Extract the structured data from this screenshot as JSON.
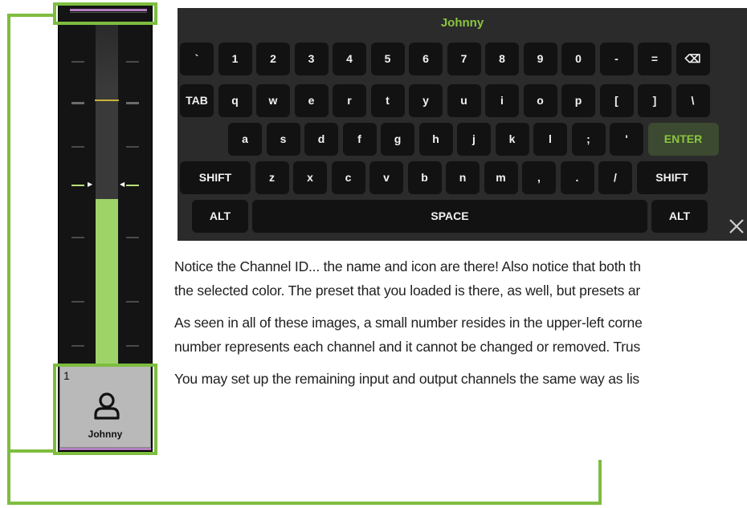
{
  "channel_strip": {
    "channel_number": "1",
    "channel_name": "Johnny",
    "icon": "person-icon",
    "accent_color": "#b27ec0",
    "meter_color": "#9ed36a",
    "meter_level": 0.49
  },
  "keyboard": {
    "title": "Johnny",
    "rows": [
      [
        "`",
        "1",
        "2",
        "3",
        "4",
        "5",
        "6",
        "7",
        "8",
        "9",
        "0",
        "-",
        "=",
        "⌫"
      ],
      [
        "TAB",
        "q",
        "w",
        "e",
        "r",
        "t",
        "y",
        "u",
        "i",
        "o",
        "p",
        "[",
        "]",
        "\\"
      ],
      [
        "a",
        "s",
        "d",
        "f",
        "g",
        "h",
        "j",
        "k",
        "l",
        ";",
        "'",
        "ENTER"
      ],
      [
        "SHIFT",
        "z",
        "x",
        "c",
        "v",
        "b",
        "n",
        "m",
        ",",
        ".",
        "/",
        "SHIFT"
      ],
      [
        "ALT",
        "SPACE",
        "ALT"
      ]
    ],
    "close_icon": "close-icon"
  },
  "text": {
    "p1_line1": "Notice the Channel ID... the name and icon are there! Also notice that both th",
    "p1_line2": "the selected color. The preset that you loaded is there, as well, but presets ar",
    "p2_line1": "As seen in all of these images, a small number resides in the upper-left corne",
    "p2_line2": "number represents each channel and it cannot be changed or removed. Trus",
    "p3_line1": "You may set up the remaining input and output channels the same way as lis"
  },
  "colors": {
    "callout": "#7dbd3f",
    "keyboard_bg": "#2b2b2b",
    "key_bg": "#121212",
    "title_green": "#8cc63f"
  }
}
